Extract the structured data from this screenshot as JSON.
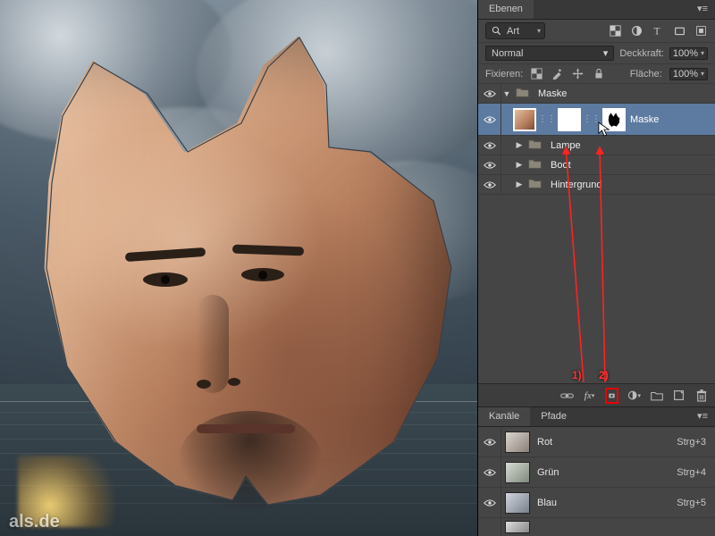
{
  "panel_tabs": {
    "layers": "Ebenen"
  },
  "search": {
    "label": "Art"
  },
  "blend": {
    "mode_label": "Normal",
    "opacity_label": "Deckkraft:",
    "opacity_value": "100%",
    "fill_label": "Fläche:",
    "fill_value": "100%"
  },
  "lock": {
    "label": "Fixieren:"
  },
  "layers": {
    "group_name": "Maske",
    "active_layer_name": "Maske",
    "items": [
      {
        "name": "Lampe"
      },
      {
        "name": "Boot"
      },
      {
        "name": "Hintergrund"
      }
    ]
  },
  "annotations": {
    "one": "1)",
    "two": "2)"
  },
  "channels_tabs": {
    "channels": "Kanäle",
    "paths": "Pfade"
  },
  "channels": [
    {
      "name": "Rot",
      "shortcut": "Strg+3"
    },
    {
      "name": "Grün",
      "shortcut": "Strg+4"
    },
    {
      "name": "Blau",
      "shortcut": "Strg+5"
    }
  ],
  "watermark": "als.de"
}
